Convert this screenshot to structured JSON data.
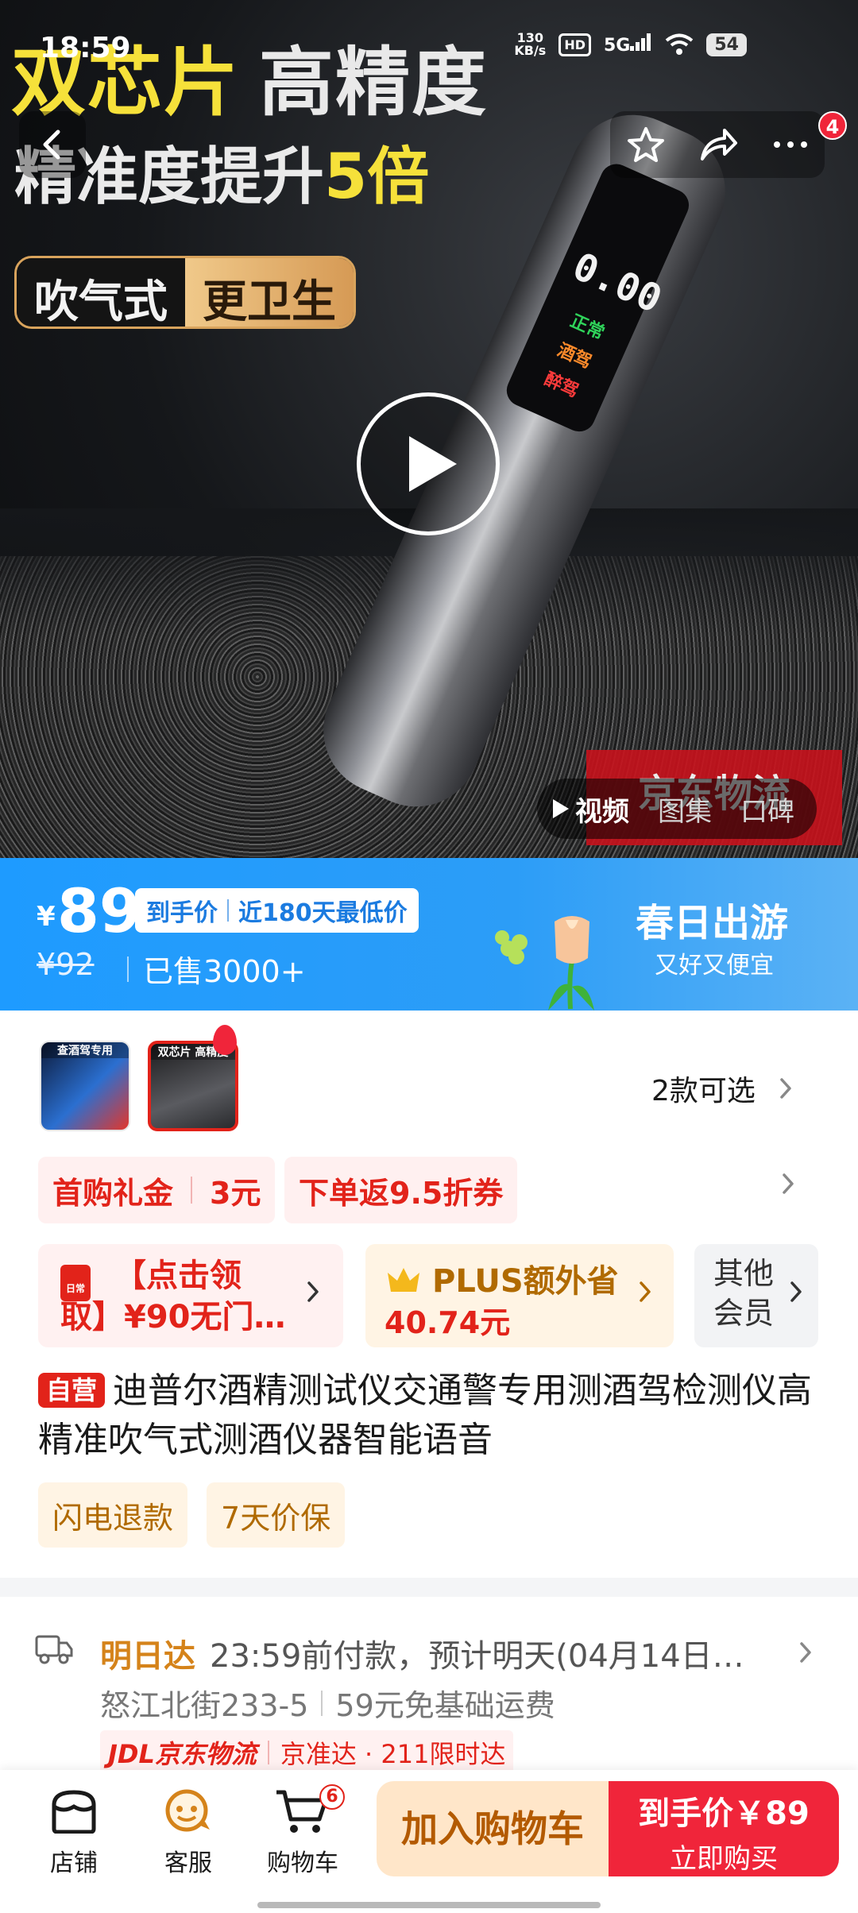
{
  "status_bar": {
    "time": "18:59",
    "net_speed_value": "130",
    "net_speed_unit": "KB/s",
    "hd": "HD",
    "network": "5G",
    "battery": "54"
  },
  "hero": {
    "promo_line1_a": "双芯片",
    "promo_line1_b": "高精度",
    "promo_line2_a": "精准度提升",
    "promo_line2_b": "5倍",
    "promo_pill_a": "吹气式",
    "promo_pill_b": "更卫生",
    "device_digits": "0.00",
    "device_tag_normal": "正常",
    "device_tag_drink": "酒驾",
    "device_tag_drunk": "醉驾",
    "jd_stamp": "京东物流",
    "media_tabs": [
      {
        "label": "视频",
        "active": true
      },
      {
        "label": "图集",
        "active": false
      },
      {
        "label": "口碑",
        "active": false
      }
    ]
  },
  "top_nav": {
    "badge_count": "4"
  },
  "price": {
    "currency": "¥",
    "amount": "89",
    "tag_a": "到手价",
    "tag_b": "近180天最低价",
    "original": "¥92",
    "sold": "已售3000+",
    "spring_title": "春日出游",
    "spring_sub": "又好又便宜"
  },
  "variants": {
    "thumb1_label": "查酒驾专用",
    "thumb2_label": "双芯片 高精度",
    "count_text": "2款可选"
  },
  "coupons": {
    "first_buy_label": "首购礼金",
    "first_buy_value": "3元",
    "rebate_label": "下单返9.5折券"
  },
  "benefits": {
    "coupon_icon_text": "日常",
    "coupon_text_line1": "【点击领",
    "coupon_text_line2": "取】¥90无门…",
    "plus_title": "PLUS额外省",
    "plus_value": "40.74元",
    "other_members": "其他会员"
  },
  "product": {
    "self_tag": "自营",
    "title": "迪普尔酒精测试仪交通警专用测酒驾检测仪高精准吹气式测酒仪器智能语音",
    "service_tags": [
      "闪电退款",
      "7天价保"
    ]
  },
  "delivery": {
    "brand": "明日达",
    "detail": "23:59前付款，预计明天(04月14日…",
    "address": "怒江北街233-5",
    "shipping": "59元免基础运费",
    "jdl_logo": "JDL京东物流",
    "jdl_service": "京准达 · 211限时达"
  },
  "bottom_bar": {
    "store": "店铺",
    "service": "客服",
    "cart": "购物车",
    "cart_count": "6",
    "add_to_cart": "加入购物车",
    "buy_price": "到手价￥89",
    "buy_now": "立即购买"
  },
  "colors": {
    "accent_red": "#e2231a",
    "price_blue": "#1e9bff",
    "gold": "#b06a00"
  }
}
